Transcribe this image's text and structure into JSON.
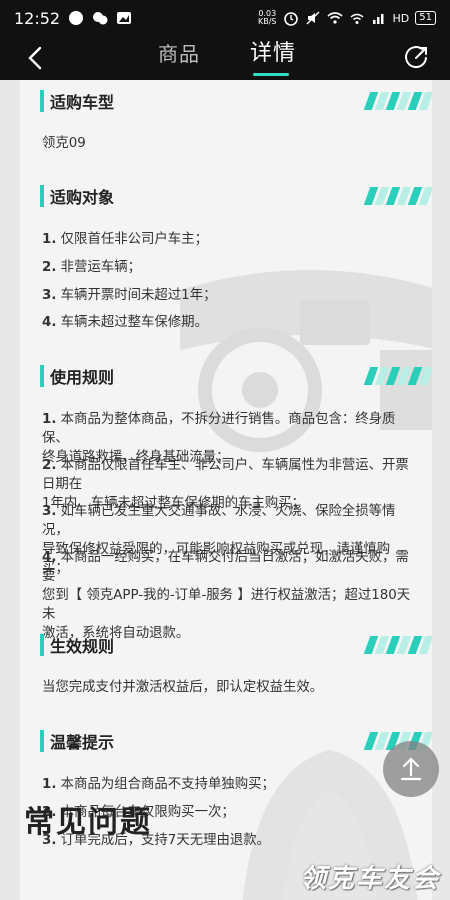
{
  "status_bar": {
    "time": "12:52",
    "network_speed_top": "0.03",
    "network_speed_unit": "KB/S",
    "network_type": "HD",
    "battery": "51"
  },
  "header": {
    "tabs": [
      {
        "label": "商品",
        "active": false
      },
      {
        "label": "详情",
        "active": true
      }
    ],
    "accent_color": "#2ee0c8"
  },
  "sections": [
    {
      "title": "适购车型",
      "items": [
        "领克09"
      ]
    },
    {
      "title": "适购对象",
      "items": [
        {
          "num": "1.",
          "text": "仅限首任非公司户车主；"
        },
        {
          "num": "2.",
          "text": "非营运车辆；"
        },
        {
          "num": "3.",
          "text": "车辆开票时间未超过1年；"
        },
        {
          "num": "4.",
          "text": "车辆未超过整车保修期。"
        }
      ]
    },
    {
      "title": "使用规则",
      "items": [
        {
          "num": "1.",
          "line1": "本商品为整体商品，不拆分进行销售。商品包含：终身质保、",
          "line2": "终身道路救援、终身基础流量；"
        },
        {
          "num": "2.",
          "line1": "本商品仅限首任车主、非公司户、车辆属性为非营运、开票日期在",
          "line2": "1年内、车辆未超过整车保修期的车主购买；"
        },
        {
          "num": "3.",
          "line1": "如车辆已发生重大交通事故、水浸、火烧、保险全损等情况，",
          "line2": "导致保修权益受限的，可能影响权益购买或兑现，请谨慎购买；"
        },
        {
          "num": "4.",
          "line1": "本商品一经购买，在车辆交付后当日激活；如激活失败，需要",
          "line2": "您到【 领克APP-我的-订单-服务 】进行权益激活；超过180天未",
          "line3": "激活，系统将自动退款。"
        }
      ]
    },
    {
      "title": "生效规则",
      "items": [
        "当您完成支付并激活权益后，即认定权益生效。"
      ]
    },
    {
      "title": "温馨提示",
      "items": [
        {
          "num": "1.",
          "text": "本商品为组合商品不支持单独购买；"
        },
        {
          "num": "2.",
          "text": "本商品每台车仅限购买一次；"
        },
        {
          "num": "3.",
          "text": "订单完成后，支持7天无理由退款。"
        }
      ]
    }
  ],
  "faq_heading": "常见问题",
  "watermark": "领克车友会"
}
